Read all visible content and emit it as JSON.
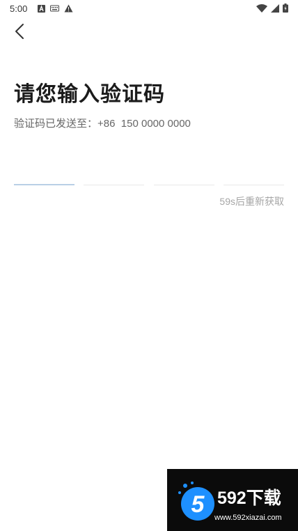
{
  "status_bar": {
    "time": "5:00",
    "left_icons": [
      "a-icon",
      "keyboard-icon",
      "warning-icon"
    ],
    "right_icons": [
      "wifi-icon",
      "signal-icon",
      "battery-icon"
    ]
  },
  "header": {
    "back_icon": "chevron-left-icon"
  },
  "main": {
    "title": "请您输入验证码",
    "sent_to_label": "验证码已发送至：",
    "phone": "+86  150 0000 0000",
    "code_inputs": [
      "",
      "",
      "",
      ""
    ],
    "resend_label": "59s后重新获取"
  },
  "watermark": {
    "brand": "592下载",
    "url": "www.592xiazai.com",
    "logo_glyph": "5"
  },
  "colors": {
    "title": "#1b1b1b",
    "secondary_text": "#666666",
    "resend_text": "#a6a6a6",
    "active_underline": "#b9cfe6",
    "inactive_underline": "#e8e8e8",
    "watermark_bg": "#0b0b0b",
    "watermark_accent": "#1e90ff"
  }
}
